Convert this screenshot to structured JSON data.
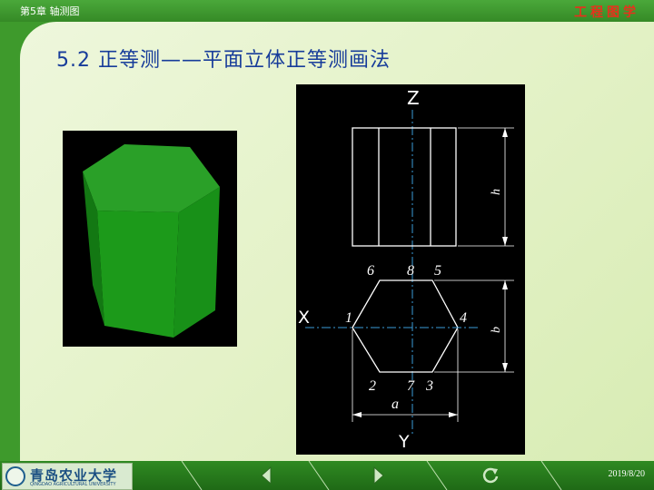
{
  "header": {
    "chapter": "第5章 轴测图",
    "brand": "工程图学"
  },
  "slide": {
    "title": "5.2 正等测——平面立体正等测画法",
    "drawing": {
      "axis_z": "Z",
      "axis_x": "X",
      "axis_y": "Y",
      "dim_h": "h",
      "dim_b": "b",
      "dim_a": "a",
      "points": [
        "1",
        "2",
        "3",
        "4",
        "5",
        "6",
        "7",
        "8"
      ]
    }
  },
  "footer": {
    "logo_text": "青岛农业大学",
    "logo_sub": "QINGDAO AGRICULTURAL UNIVERSITY",
    "date": "2019/8/20",
    "nav": [
      "previous",
      "next",
      "return"
    ]
  },
  "colors": {
    "title": "#173c9a",
    "prism": "#1f8f1c",
    "brand": "#e8301c"
  }
}
